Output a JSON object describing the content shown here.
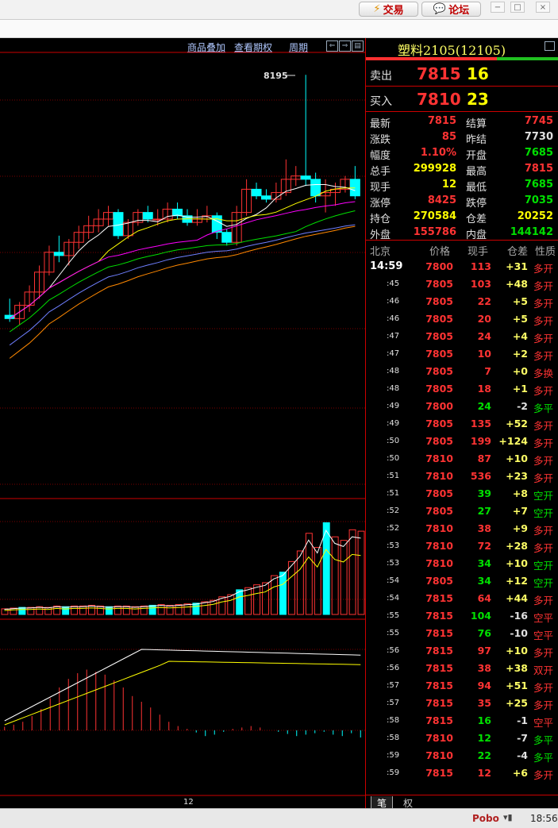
{
  "topbar": {
    "trade_label": "交易",
    "forum_label": "论坛"
  },
  "toolbar": {
    "overlay": "商品叠加",
    "options": "查看期权",
    "period": "周期"
  },
  "chart": {
    "high_label": "8195",
    "x_label": "12"
  },
  "colors": {
    "up": "#ff3333",
    "down": "#00ffff",
    "yellow": "#ffff00",
    "green": "#00e000",
    "grid": "#7a0000",
    "text": "#e0e0e0"
  },
  "chart_data": [
    {
      "type": "candlestick",
      "title": "",
      "ohlc": [
        [
          7470,
          7520,
          7450,
          7460
        ],
        [
          7460,
          7510,
          7440,
          7500
        ],
        [
          7500,
          7560,
          7480,
          7540
        ],
        [
          7540,
          7620,
          7520,
          7600
        ],
        [
          7600,
          7680,
          7590,
          7660
        ],
        [
          7660,
          7710,
          7630,
          7650
        ],
        [
          7650,
          7700,
          7620,
          7690
        ],
        [
          7690,
          7740,
          7670,
          7720
        ],
        [
          7720,
          7770,
          7700,
          7740
        ],
        [
          7740,
          7790,
          7720,
          7760
        ],
        [
          7760,
          7800,
          7740,
          7780
        ],
        [
          7780,
          7790,
          7700,
          7710
        ],
        [
          7710,
          7760,
          7700,
          7750
        ],
        [
          7750,
          7790,
          7740,
          7780
        ],
        [
          7780,
          7800,
          7750,
          7760
        ],
        [
          7760,
          7790,
          7740,
          7760
        ],
        [
          7760,
          7810,
          7750,
          7790
        ],
        [
          7790,
          7810,
          7760,
          7770
        ],
        [
          7770,
          7790,
          7740,
          7750
        ],
        [
          7750,
          7790,
          7740,
          7760
        ],
        [
          7760,
          7800,
          7750,
          7770
        ],
        [
          7770,
          7780,
          7700,
          7720
        ],
        [
          7720,
          7730,
          7680,
          7690
        ],
        [
          7690,
          7800,
          7680,
          7780
        ],
        [
          7780,
          7880,
          7770,
          7850
        ],
        [
          7850,
          7870,
          7820,
          7830
        ],
        [
          7830,
          7850,
          7810,
          7820
        ],
        [
          7820,
          7870,
          7810,
          7840
        ],
        [
          7840,
          7940,
          7830,
          7880
        ],
        [
          7880,
          7920,
          7860,
          7890
        ],
        [
          7890,
          8195,
          7860,
          7880
        ],
        [
          7880,
          7900,
          7810,
          7830
        ],
        [
          7830,
          7880,
          7780,
          7840
        ],
        [
          7840,
          7870,
          7800,
          7850
        ],
        [
          7850,
          7890,
          7840,
          7880
        ],
        [
          7880,
          7920,
          7820,
          7830
        ]
      ]
    },
    {
      "type": "bar",
      "title": "",
      "values": [
        8,
        9,
        10,
        10,
        11,
        10,
        12,
        11,
        12,
        12,
        13,
        12,
        11,
        12,
        12,
        11,
        12,
        13,
        14,
        13,
        14,
        15,
        16,
        18,
        20,
        25,
        28,
        35,
        38,
        42,
        45,
        55,
        60,
        75,
        90,
        115,
        95,
        130,
        110,
        105,
        120,
        118
      ]
    },
    {
      "type": "bar",
      "title": "",
      "values": [
        5,
        8,
        12,
        20,
        30,
        45,
        60,
        72,
        80,
        85,
        82,
        78,
        70,
        60,
        48,
        40,
        32,
        22,
        12,
        6,
        2,
        -3,
        -8,
        -6,
        -2,
        2,
        4,
        6,
        4,
        0,
        -2,
        -5,
        -8,
        -6,
        -4,
        -2,
        -6,
        -8,
        -4,
        -10
      ]
    }
  ],
  "right": {
    "title": "塑料2105(12105)",
    "sell_label": "卖出",
    "sell_price": "7815",
    "sell_vol": "16",
    "buy_label": "买入",
    "buy_price": "7810",
    "buy_vol": "23",
    "stats": [
      {
        "l1": "最新",
        "v1": "7815",
        "c1": "#ff3333",
        "l2": "结算",
        "v2": "7745",
        "c2": "#ff3333"
      },
      {
        "l1": "涨跌",
        "v1": "85",
        "c1": "#ff3333",
        "l2": "昨结",
        "v2": "7730",
        "c2": "#e0e0e0"
      },
      {
        "l1": "幅度",
        "v1": "1.10%",
        "c1": "#ff3333",
        "l2": "开盘",
        "v2": "7685",
        "c2": "#00e000"
      },
      {
        "l1": "总手",
        "v1": "299928",
        "c1": "#ffff00",
        "l2": "最高",
        "v2": "7815",
        "c2": "#ff3333"
      },
      {
        "l1": "现手",
        "v1": "12",
        "c1": "#ffff00",
        "l2": "最低",
        "v2": "7685",
        "c2": "#00e000"
      },
      {
        "l1": "涨停",
        "v1": "8425",
        "c1": "#ff3333",
        "l2": "跌停",
        "v2": "7035",
        "c2": "#00e000"
      },
      {
        "l1": "持仓",
        "v1": "270584",
        "c1": "#ffff00",
        "l2": "仓差",
        "v2": "20252",
        "c2": "#ffff00"
      },
      {
        "l1": "外盘",
        "v1": "155786",
        "c1": "#ff3333",
        "l2": "内盘",
        "v2": "144142",
        "c2": "#00e000"
      }
    ],
    "tick_header": {
      "c0": "北京",
      "c1": "价格",
      "c2": "现手",
      "c3": "仓差",
      "c4": "性质"
    },
    "ticks": [
      {
        "t": "14:59",
        "p": "7800",
        "v": "113",
        "d": "+31",
        "n": "多开"
      },
      {
        "t": ":45",
        "p": "7805",
        "v": "103",
        "d": "+48",
        "n": "多开"
      },
      {
        "t": ":46",
        "p": "7805",
        "v": "22",
        "d": "+5",
        "n": "多开"
      },
      {
        "t": ":46",
        "p": "7805",
        "v": "20",
        "d": "+5",
        "n": "多开"
      },
      {
        "t": ":47",
        "p": "7805",
        "v": "24",
        "d": "+4",
        "n": "多开"
      },
      {
        "t": ":47",
        "p": "7805",
        "v": "10",
        "d": "+2",
        "n": "多开"
      },
      {
        "t": ":48",
        "p": "7805",
        "v": "7",
        "d": "+0",
        "n": "多换"
      },
      {
        "t": ":48",
        "p": "7805",
        "v": "18",
        "d": "+1",
        "n": "多开"
      },
      {
        "t": ":49",
        "p": "7800",
        "v": "24",
        "d": "-2",
        "n": "多平"
      },
      {
        "t": ":49",
        "p": "7805",
        "v": "135",
        "d": "+52",
        "n": "多开"
      },
      {
        "t": ":50",
        "p": "7805",
        "v": "199",
        "d": "+124",
        "n": "多开"
      },
      {
        "t": ":50",
        "p": "7810",
        "v": "87",
        "d": "+10",
        "n": "多开"
      },
      {
        "t": ":51",
        "p": "7810",
        "v": "536",
        "d": "+23",
        "n": "多开"
      },
      {
        "t": ":51",
        "p": "7805",
        "v": "39",
        "d": "+8",
        "n": "空开"
      },
      {
        "t": ":52",
        "p": "7805",
        "v": "27",
        "d": "+7",
        "n": "空开"
      },
      {
        "t": ":52",
        "p": "7810",
        "v": "38",
        "d": "+9",
        "n": "多开"
      },
      {
        "t": ":53",
        "p": "7810",
        "v": "72",
        "d": "+28",
        "n": "多开"
      },
      {
        "t": ":53",
        "p": "7810",
        "v": "34",
        "d": "+10",
        "n": "空开"
      },
      {
        "t": ":54",
        "p": "7805",
        "v": "34",
        "d": "+12",
        "n": "空开"
      },
      {
        "t": ":54",
        "p": "7815",
        "v": "64",
        "d": "+44",
        "n": "多开"
      },
      {
        "t": ":55",
        "p": "7815",
        "v": "104",
        "d": "-16",
        "n": "空平"
      },
      {
        "t": ":55",
        "p": "7815",
        "v": "76",
        "d": "-10",
        "n": "空平"
      },
      {
        "t": ":56",
        "p": "7815",
        "v": "97",
        "d": "+10",
        "n": "多开"
      },
      {
        "t": ":56",
        "p": "7815",
        "v": "38",
        "d": "+38",
        "n": "双开"
      },
      {
        "t": ":57",
        "p": "7815",
        "v": "94",
        "d": "+51",
        "n": "多开"
      },
      {
        "t": ":57",
        "p": "7815",
        "v": "35",
        "d": "+25",
        "n": "多开"
      },
      {
        "t": ":58",
        "p": "7815",
        "v": "16",
        "d": "-1",
        "n": "空平"
      },
      {
        "t": ":58",
        "p": "7810",
        "v": "12",
        "d": "-7",
        "n": "多平"
      },
      {
        "t": ":59",
        "p": "7810",
        "v": "22",
        "d": "-4",
        "n": "多平"
      },
      {
        "t": ":59",
        "p": "7815",
        "v": "12",
        "d": "+6",
        "n": "多开"
      }
    ],
    "tabs": [
      "笔",
      "权"
    ]
  },
  "statusbar": {
    "brand": "Pobo",
    "time": "18:56"
  }
}
